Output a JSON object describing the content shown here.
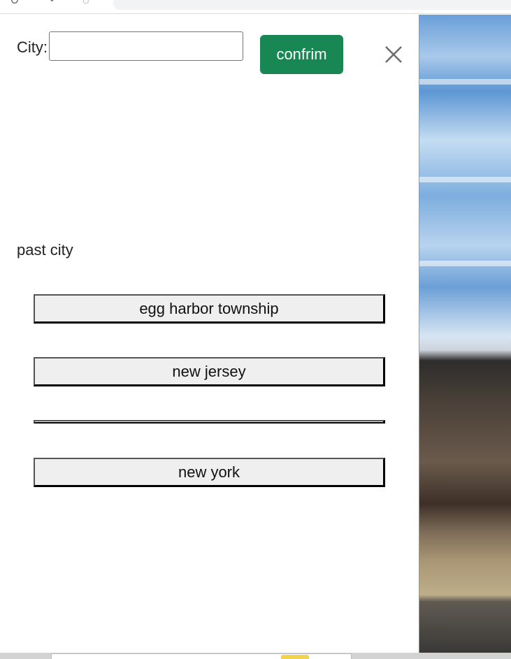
{
  "city_form": {
    "label": "City:",
    "input_value": "",
    "input_placeholder": "",
    "confirm_label": "confrim"
  },
  "history": {
    "heading": "past city",
    "items": [
      {
        "label": "egg harbor township"
      },
      {
        "label": "new jersey"
      },
      {
        "label": ""
      },
      {
        "label": "new york"
      }
    ]
  },
  "colors": {
    "confirm_bg": "#198754",
    "confirm_text": "#ffffff",
    "history_item_bg": "#efefef"
  },
  "icons": {
    "close": "close-icon"
  }
}
